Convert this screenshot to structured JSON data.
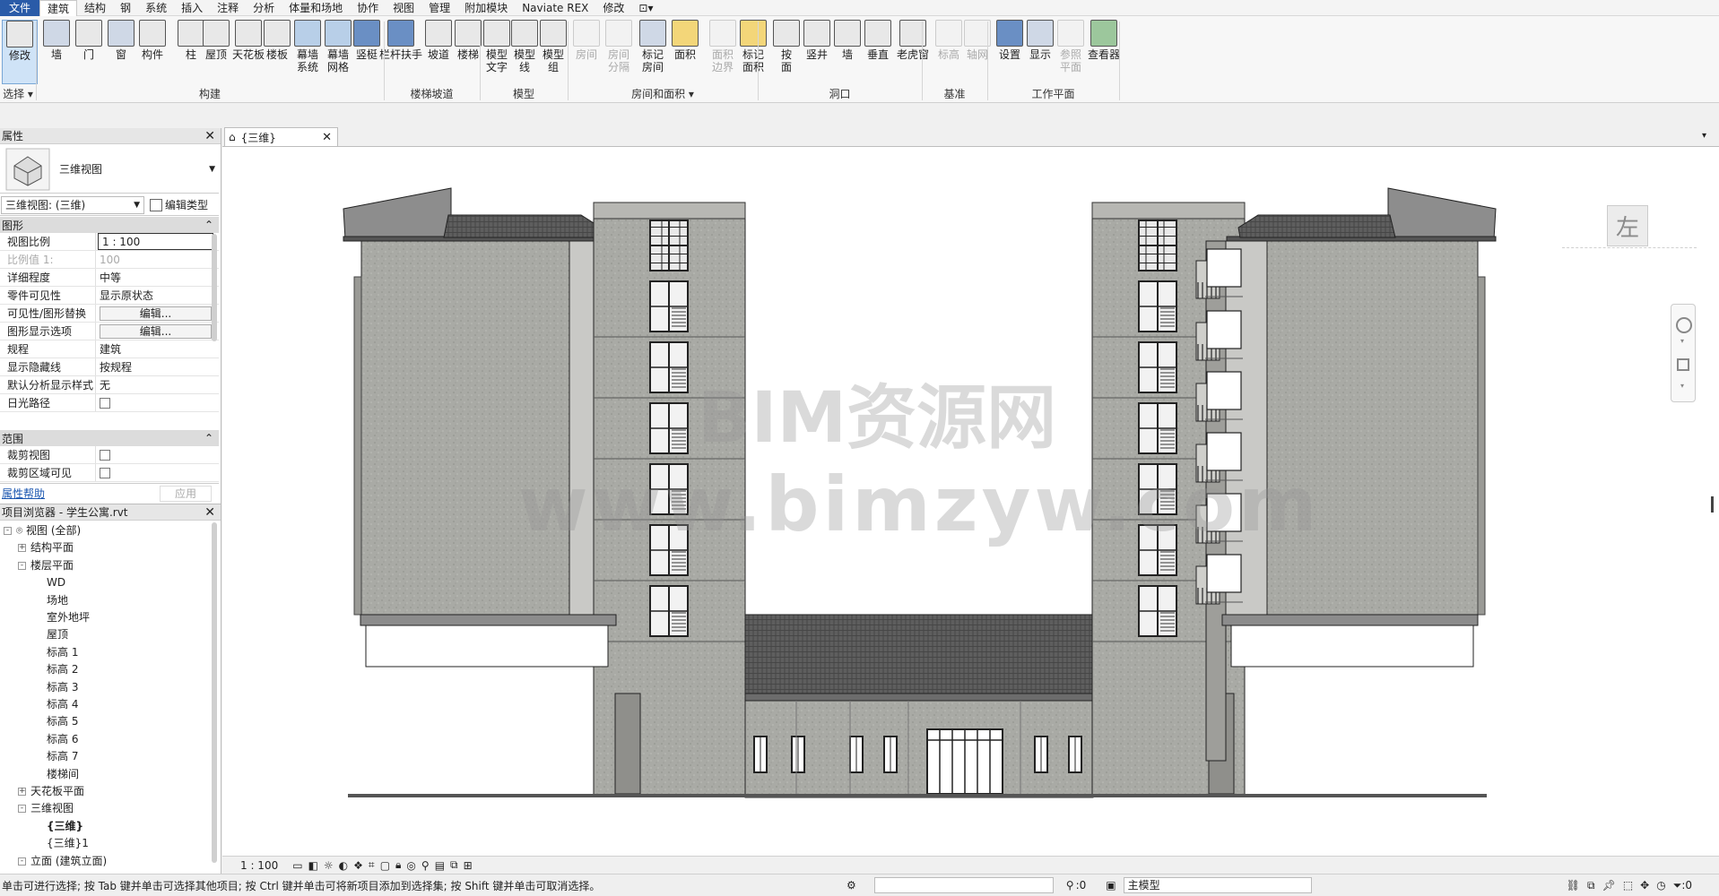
{
  "menu": [
    "文件",
    "建筑",
    "结构",
    "钢",
    "系统",
    "插入",
    "注释",
    "分析",
    "体量和场地",
    "协作",
    "视图",
    "管理",
    "附加模块",
    "Naviate REX",
    "修改"
  ],
  "ribbon": {
    "buttons": [
      {
        "label": "修改",
        "icon": "cursor-arrow-icon",
        "dim": false,
        "sel": true
      },
      {
        "label": "墙",
        "icon": "wall-icon",
        "dim": false
      },
      {
        "label": "门",
        "icon": "door-icon",
        "dim": false
      },
      {
        "label": "窗",
        "icon": "window-icon",
        "dim": false
      },
      {
        "label": "构件",
        "icon": "component-icon",
        "dim": false
      },
      {
        "label": "柱",
        "icon": "column-icon",
        "dim": false
      },
      {
        "label": "屋顶",
        "icon": "roof-icon",
        "dim": false
      },
      {
        "label": "天花板",
        "icon": "ceiling-icon",
        "dim": false
      },
      {
        "label": "楼板",
        "icon": "floor-icon",
        "dim": false
      },
      {
        "label": "幕墙\n系统",
        "icon": "curtain-system-icon",
        "dim": false
      },
      {
        "label": "幕墙\n网格",
        "icon": "curtain-grid-icon",
        "dim": false
      },
      {
        "label": "竖梃",
        "icon": "mullion-icon",
        "dim": false
      },
      {
        "label": "栏杆扶手",
        "icon": "railing-icon",
        "dim": false
      },
      {
        "label": "坡道",
        "icon": "ramp-icon",
        "dim": false
      },
      {
        "label": "楼梯",
        "icon": "stair-icon",
        "dim": false
      },
      {
        "label": "模型\n文字",
        "icon": "model-text-icon",
        "dim": false
      },
      {
        "label": "模型\n线",
        "icon": "model-line-icon",
        "dim": false
      },
      {
        "label": "模型\n组",
        "icon": "model-group-icon",
        "dim": false
      },
      {
        "label": "房间",
        "icon": "room-icon",
        "dim": true
      },
      {
        "label": "房间\n分隔",
        "icon": "room-separator-icon",
        "dim": true
      },
      {
        "label": "标记\n房间",
        "icon": "tag-room-icon",
        "dim": false
      },
      {
        "label": "面积",
        "icon": "area-icon",
        "dim": false
      },
      {
        "label": "面积\n边界",
        "icon": "area-boundary-icon",
        "dim": true
      },
      {
        "label": "标记\n面积",
        "icon": "tag-area-icon",
        "dim": false
      },
      {
        "label": "按\n面",
        "icon": "opening-by-face-icon",
        "dim": false
      },
      {
        "label": "竖井",
        "icon": "shaft-icon",
        "dim": false
      },
      {
        "label": "墙",
        "icon": "wall-opening-icon",
        "dim": false
      },
      {
        "label": "垂直",
        "icon": "vertical-opening-icon",
        "dim": false
      },
      {
        "label": "老虎窗",
        "icon": "dormer-icon",
        "dim": false
      },
      {
        "label": "标高",
        "icon": "level-icon",
        "dim": true
      },
      {
        "label": "轴网",
        "icon": "grid-icon",
        "dim": true
      },
      {
        "label": "设置",
        "icon": "set-workplane-icon",
        "dim": false
      },
      {
        "label": "显示",
        "icon": "show-workplane-icon",
        "dim": false
      },
      {
        "label": "参照\n平面",
        "icon": "ref-plane-icon",
        "dim": true
      },
      {
        "label": "查看器",
        "icon": "viewer-icon",
        "dim": false
      }
    ],
    "groups": [
      "选择 ▾",
      "构建",
      "楼梯坡道",
      "模型",
      "房间和面积 ▾",
      "洞口",
      "基准",
      "工作平面"
    ]
  },
  "properties": {
    "title": "属性",
    "type_name": "三维视图",
    "view_selector": "三维视图: (三维)",
    "edit_type": "编辑类型",
    "sec_graphics": "图形",
    "sec_extents": "范围",
    "rows": [
      {
        "k": "视图比例",
        "v": "1 : 100",
        "kind": "input"
      },
      {
        "k": "比例值 1:",
        "v": "100",
        "kind": "dim"
      },
      {
        "k": "详细程度",
        "v": "中等",
        "kind": "text"
      },
      {
        "k": "零件可见性",
        "v": "显示原状态",
        "kind": "text"
      },
      {
        "k": "可见性/图形替换",
        "v": "编辑...",
        "kind": "btn"
      },
      {
        "k": "图形显示选项",
        "v": "编辑...",
        "kind": "btn"
      },
      {
        "k": "规程",
        "v": "建筑",
        "kind": "text"
      },
      {
        "k": "显示隐藏线",
        "v": "按规程",
        "kind": "text"
      },
      {
        "k": "默认分析显示样式",
        "v": "无",
        "kind": "text"
      },
      {
        "k": "日光路径",
        "v": "",
        "kind": "chk"
      }
    ],
    "rows2": [
      {
        "k": "裁剪视图",
        "v": "",
        "kind": "chk"
      },
      {
        "k": "裁剪区域可见",
        "v": "",
        "kind": "chk"
      }
    ],
    "help": "属性帮助",
    "apply": "应用"
  },
  "browser": {
    "title": "项目浏览器 - 学生公寓.rvt",
    "items": [
      {
        "t": "视图 (全部)",
        "lvl": 0,
        "tog": "-"
      },
      {
        "t": "结构平面",
        "lvl": 1,
        "tog": "+"
      },
      {
        "t": "楼层平面",
        "lvl": 1,
        "tog": "-"
      },
      {
        "t": "WD",
        "lvl": 2,
        "tog": ""
      },
      {
        "t": "场地",
        "lvl": 2,
        "tog": ""
      },
      {
        "t": "室外地坪",
        "lvl": 2,
        "tog": ""
      },
      {
        "t": "屋顶",
        "lvl": 2,
        "tog": ""
      },
      {
        "t": "标高 1",
        "lvl": 2,
        "tog": ""
      },
      {
        "t": "标高 2",
        "lvl": 2,
        "tog": ""
      },
      {
        "t": "标高 3",
        "lvl": 2,
        "tog": ""
      },
      {
        "t": "标高 4",
        "lvl": 2,
        "tog": ""
      },
      {
        "t": "标高 5",
        "lvl": 2,
        "tog": ""
      },
      {
        "t": "标高 6",
        "lvl": 2,
        "tog": ""
      },
      {
        "t": "标高 7",
        "lvl": 2,
        "tog": ""
      },
      {
        "t": "楼梯间",
        "lvl": 2,
        "tog": ""
      },
      {
        "t": "天花板平面",
        "lvl": 1,
        "tog": "+"
      },
      {
        "t": "三维视图",
        "lvl": 1,
        "tog": "-"
      },
      {
        "t": "{三维}",
        "lvl": 2,
        "tog": "",
        "bold": true
      },
      {
        "t": "{三维}1",
        "lvl": 2,
        "tog": ""
      },
      {
        "t": "立面 (建筑立面)",
        "lvl": 1,
        "tog": "-"
      }
    ]
  },
  "view": {
    "tab_label": "{三维}",
    "viewcube_face": "左",
    "watermark_cn": "BIM资源网",
    "watermark_url": "www.bimzyw.com",
    "scale": "1 : 100"
  },
  "status": {
    "hint": "单击可进行选择; 按 Tab 键并单击可选择其他项目; 按 Ctrl 键并单击可将新项目添加到选择集; 按 Shift 键并单击可取消选择。",
    "filter_count": ":0",
    "model": "主模型",
    "sel_count": ":0"
  }
}
